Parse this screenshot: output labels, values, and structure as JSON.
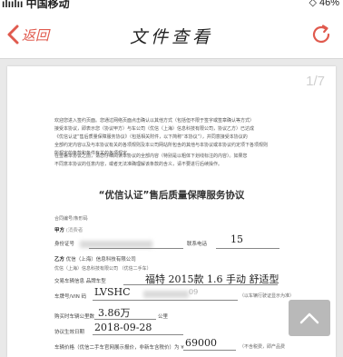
{
  "status_bar": {
    "carrier": "ılıılıı 中国移动",
    "battery": "◇ 46%"
  },
  "nav": {
    "back_label": "返回",
    "title": "文件查看"
  },
  "document": {
    "page_indicator": "1/7",
    "intro_lines": [
      "欢迎您进入签约页面。您通过网络页面点击确认以其他方式（包括但不限于签字或签章确认等方式）",
      "接受本协议，即表示您（协议甲方）与车公司（优信（上海）信息科技有限公司，协议乙方）已达成",
      "《优信认证”售后质量保障服务协议》（包括相关附件，以下简称“本协议”），并同意接受本协议的",
      "全部约定内容以及与本协议有关的各项规则及本公司网站所包含的其他与本协议或本协议约定项下各项规则",
      "所规定的条款和条件有关的各项规定。"
    ],
    "second_lines": [
      "在签署本协议之前，请您仔细阅读本协议的全部内容（特别是以粗体下划线标注的内容）。如果您",
      "不同意本协议的任意内容，或者无法准确理解该条款的含义，请不要进行后续操作。"
    ],
    "title": "“优信认证”售后质量保障服务协议",
    "contract_no_label": "合同编号/条形码",
    "party_a_label": "甲方",
    "party_a_value": "(消费者",
    "id_label": "身份证号",
    "contact_label": "联系电话",
    "contact_value": "15",
    "party_b_label": "乙方",
    "party_b_value": "优信（上海）信息科技有限公司",
    "party_b_sub": "优信（上海）信息科技有限公司 （优信二手车）",
    "vehicle_label": "交易车辆信息 品牌车型",
    "vehicle_value": "福特 2015款 1.6 手动 舒适型",
    "vin_label": "车牌号/VIN 码",
    "vin_value": "LVSHC",
    "vin_value_tail": "09",
    "vin_note": "（以车辆行驶证显示为准）",
    "mileage_label": "购买时车辆公里数",
    "mileage_value": "3.86万",
    "mileage_unit": "公里",
    "date_label": "协议生效日期",
    "date_value": "2018-09-28",
    "price_label": "车辆价格（优信二手车官网展示报价，非新车含税价）为 ¥",
    "price_value": "69000",
    "price_note": "（不含税费，即产品费"
  },
  "colors": {
    "accent": "#e05a4e",
    "fab": "#b9b9b9"
  }
}
